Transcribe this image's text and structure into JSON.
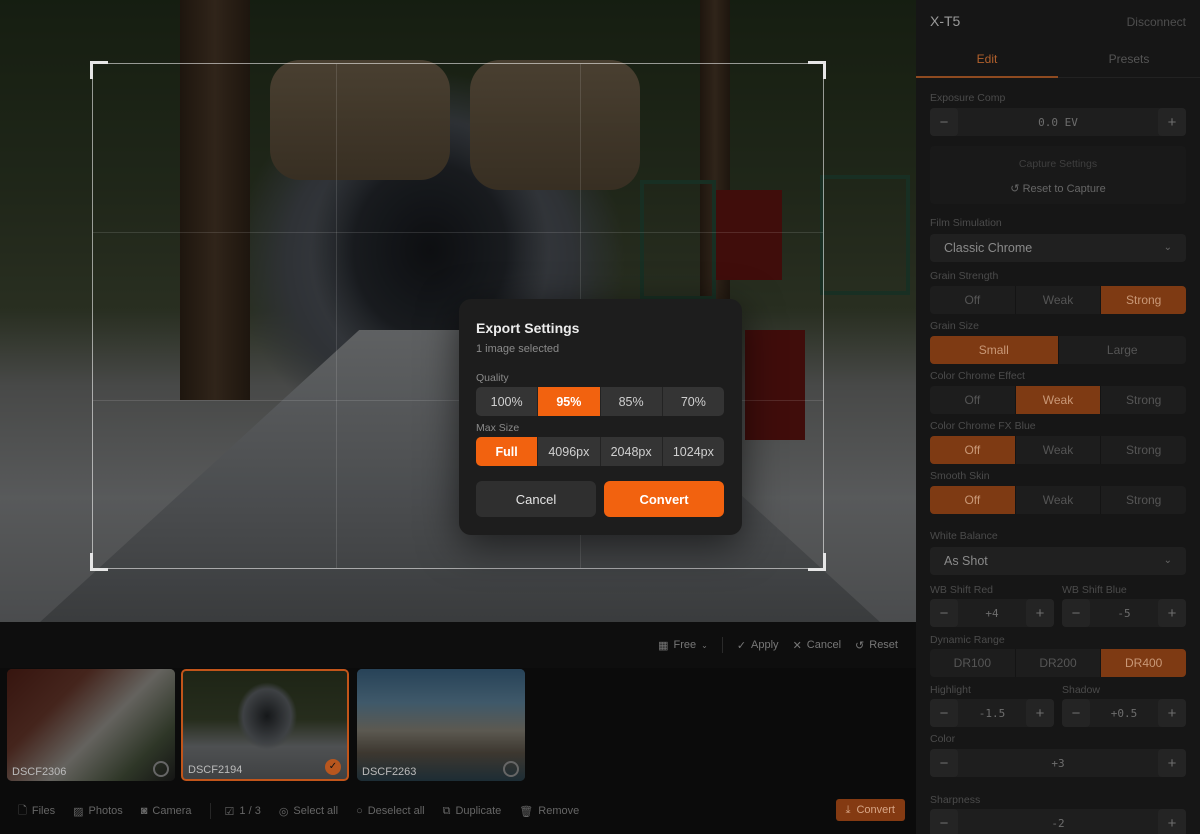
{
  "panel": {
    "device_name": "X-T5",
    "disconnect": "Disconnect",
    "tabs": {
      "edit": "Edit",
      "presets": "Presets"
    },
    "exposure": {
      "label": "Exposure Comp",
      "value": "0.0 EV"
    },
    "capture": {
      "label": "Capture Settings",
      "reset": "Reset to Capture"
    },
    "film_sim": {
      "label": "Film Simulation",
      "value": "Classic Chrome"
    },
    "grain_strength": {
      "label": "Grain Strength",
      "options": [
        "Off",
        "Weak",
        "Strong"
      ],
      "selected": "Strong"
    },
    "grain_size": {
      "label": "Grain Size",
      "options": [
        "Small",
        "Large"
      ],
      "selected": "Small"
    },
    "color_chrome": {
      "label": "Color Chrome Effect",
      "options": [
        "Off",
        "Weak",
        "Strong"
      ],
      "selected": "Weak"
    },
    "color_chrome_blue": {
      "label": "Color Chrome FX Blue",
      "options": [
        "Off",
        "Weak",
        "Strong"
      ],
      "selected": "Off"
    },
    "smooth_skin": {
      "label": "Smooth Skin",
      "options": [
        "Off",
        "Weak",
        "Strong"
      ],
      "selected": "Off"
    },
    "white_balance": {
      "label": "White Balance",
      "value": "As Shot"
    },
    "wb_shift_red": {
      "label": "WB Shift Red",
      "value": "+4"
    },
    "wb_shift_blue": {
      "label": "WB Shift Blue",
      "value": "-5"
    },
    "dynamic_range": {
      "label": "Dynamic Range",
      "options": [
        "DR100",
        "DR200",
        "DR400"
      ],
      "selected": "DR400"
    },
    "highlight": {
      "label": "Highlight",
      "value": "-1.5"
    },
    "shadow": {
      "label": "Shadow",
      "value": "+0.5"
    },
    "color": {
      "label": "Color",
      "value": "+3"
    },
    "sharpness": {
      "label": "Sharpness",
      "value": "-2"
    },
    "minus": "−",
    "plus": "+"
  },
  "crop_toolbar": {
    "free": "Free",
    "apply": "Apply",
    "cancel": "Cancel",
    "reset": "Reset"
  },
  "filmstrip": [
    {
      "name": "DSCF2306",
      "selected": false
    },
    {
      "name": "DSCF2194",
      "selected": true
    },
    {
      "name": "DSCF2263",
      "selected": false
    }
  ],
  "bottombar": {
    "files": "Files",
    "photos": "Photos",
    "camera": "Camera",
    "count": "1 / 3",
    "select_all": "Select all",
    "deselect_all": "Deselect all",
    "duplicate": "Duplicate",
    "remove": "Remove",
    "convert": "Convert"
  },
  "modal": {
    "title": "Export Settings",
    "subtitle": "1 image selected",
    "quality_label": "Quality",
    "quality_options": [
      "100%",
      "95%",
      "85%",
      "70%"
    ],
    "quality_selected": "95%",
    "size_label": "Max Size",
    "size_options": [
      "Full",
      "4096px",
      "2048px",
      "1024px"
    ],
    "size_selected": "Full",
    "cancel": "Cancel",
    "convert": "Convert"
  },
  "colors": {
    "accent": "#f2620f",
    "accent_dim": "#7e3a13",
    "panel_bg": "#161616",
    "modal_bg": "#1d1d1d"
  }
}
